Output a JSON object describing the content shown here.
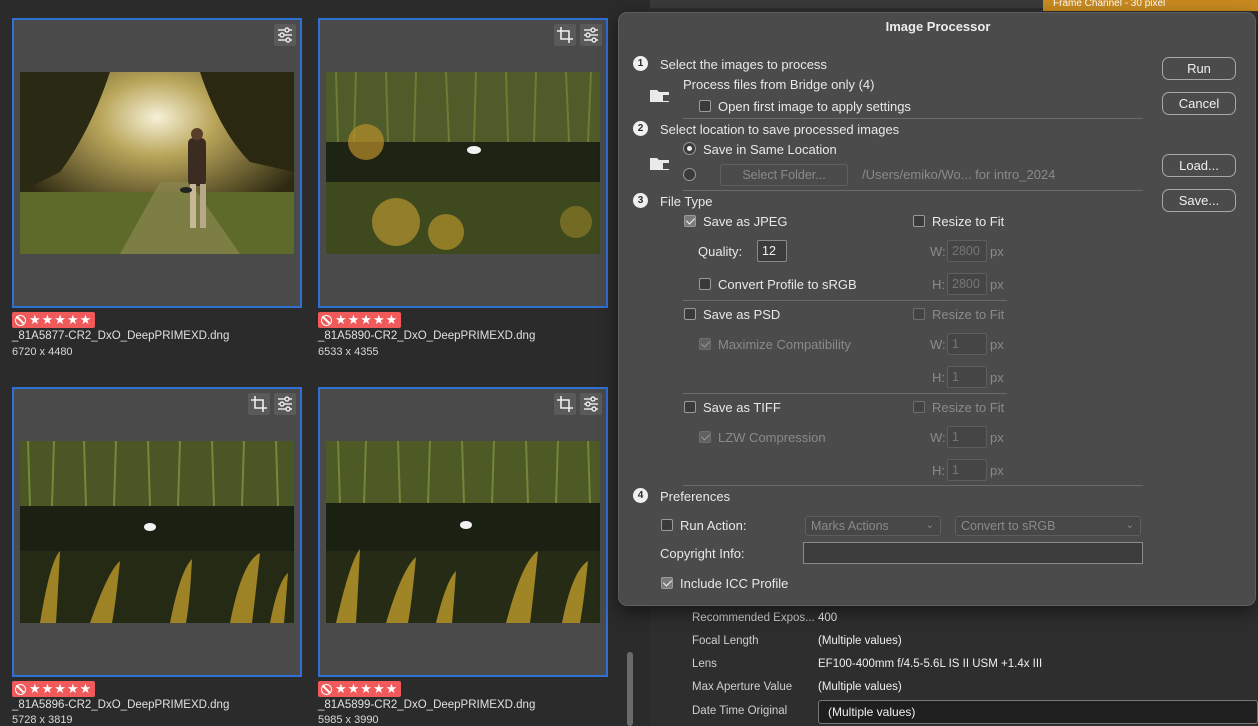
{
  "thumbnails": [
    {
      "filename": "_81A5877-CR2_DxO_DeepPRIMEXD.dng",
      "dimensions": "6720 x 4480",
      "rating": "★★★★★",
      "icons": [
        "adjust-icon"
      ]
    },
    {
      "filename": "_81A5890-CR2_DxO_DeepPRIMEXD.dng",
      "dimensions": "6533 x 4355",
      "rating": "★★★★★",
      "icons": [
        "crop-icon",
        "adjust-icon"
      ]
    },
    {
      "filename": "_81A5896-CR2_DxO_DeepPRIMEXD.dng",
      "dimensions": "5728 x 3819",
      "rating": "★★★★★",
      "icons": [
        "crop-icon",
        "adjust-icon"
      ]
    },
    {
      "filename": "_81A5899-CR2_DxO_DeepPRIMEXD.dng",
      "dimensions": "5985 x 3990",
      "rating": "★★★★★",
      "icons": [
        "crop-icon",
        "adjust-icon"
      ]
    }
  ],
  "right_panel": {
    "top_bar_text": "Frame Channel - 30 pixel",
    "metadata": [
      {
        "label": "Recommended Expos...",
        "value": "400"
      },
      {
        "label": "Focal Length",
        "value": "(Multiple values)"
      },
      {
        "label": "Lens",
        "value": "EF100-400mm f/4.5-5.6L IS II USM +1.4x III"
      },
      {
        "label": "Max Aperture Value",
        "value": "(Multiple values)"
      },
      {
        "label": "Date Time Original",
        "value": "(Multiple values)"
      }
    ]
  },
  "dialog": {
    "title": "Image Processor",
    "buttons": {
      "run": "Run",
      "cancel": "Cancel",
      "load": "Load...",
      "save": "Save..."
    },
    "section1": {
      "num": "1",
      "title": "Select the images to process",
      "source": "Process files from Bridge only (4)",
      "open_first": "Open first image to apply settings"
    },
    "section2": {
      "num": "2",
      "title": "Select location to save processed images",
      "same_location": "Save in Same Location",
      "select_folder": "Select Folder...",
      "path": "/Users/emiko/Wo... for intro_2024"
    },
    "section3": {
      "num": "3",
      "title": "File Type",
      "jpeg": {
        "label": "Save as JPEG",
        "quality_label": "Quality:",
        "quality": "12",
        "convert": "Convert Profile to sRGB",
        "resize": "Resize to Fit",
        "w": "2800",
        "h": "2800"
      },
      "psd": {
        "label": "Save as PSD",
        "maximize": "Maximize Compatibility",
        "resize": "Resize to Fit",
        "w": "1",
        "h": "1"
      },
      "tiff": {
        "label": "Save as TIFF",
        "lzw": "LZW Compression",
        "resize": "Resize to Fit",
        "w": "1",
        "h": "1"
      },
      "w_label": "W:",
      "h_label": "H:",
      "px": "px"
    },
    "section4": {
      "num": "4",
      "title": "Preferences",
      "run_action": "Run Action:",
      "action_set": "Marks Actions",
      "action": "Convert to sRGB",
      "copyright": "Copyright Info:",
      "icc": "Include ICC Profile"
    }
  },
  "colors": {
    "selection": "#2f6fd6",
    "reject": "#f05a5a",
    "dialog": "#4b4b4b",
    "accent_bar": "#c98a1f"
  }
}
